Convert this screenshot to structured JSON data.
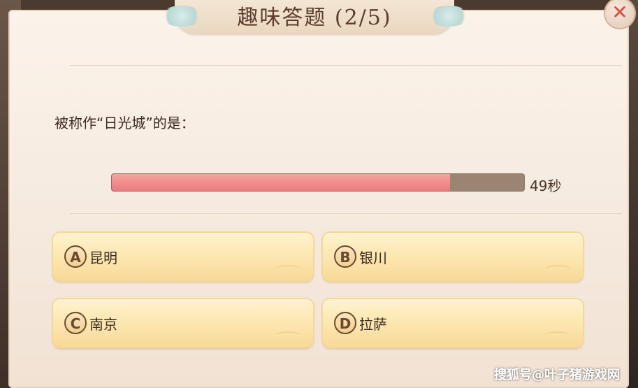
{
  "dialog": {
    "title": "趣味答题 (2/5)",
    "close_icon": "close-icon",
    "question": "被称作“日光城”的是："
  },
  "timer": {
    "remaining_text": "49秒",
    "progress_fraction": 0.82
  },
  "options": [
    {
      "letter": "A",
      "text": "昆明"
    },
    {
      "letter": "B",
      "text": "银川"
    },
    {
      "letter": "C",
      "text": "南京"
    },
    {
      "letter": "D",
      "text": "拉萨"
    }
  ],
  "watermark": "搜狐号@叶子猪游戏网",
  "colors": {
    "timer_fill": "#e97a7c",
    "timer_track": "#9c8473",
    "option_bg": "#fde8b3",
    "close_x": "#d84a3e"
  }
}
